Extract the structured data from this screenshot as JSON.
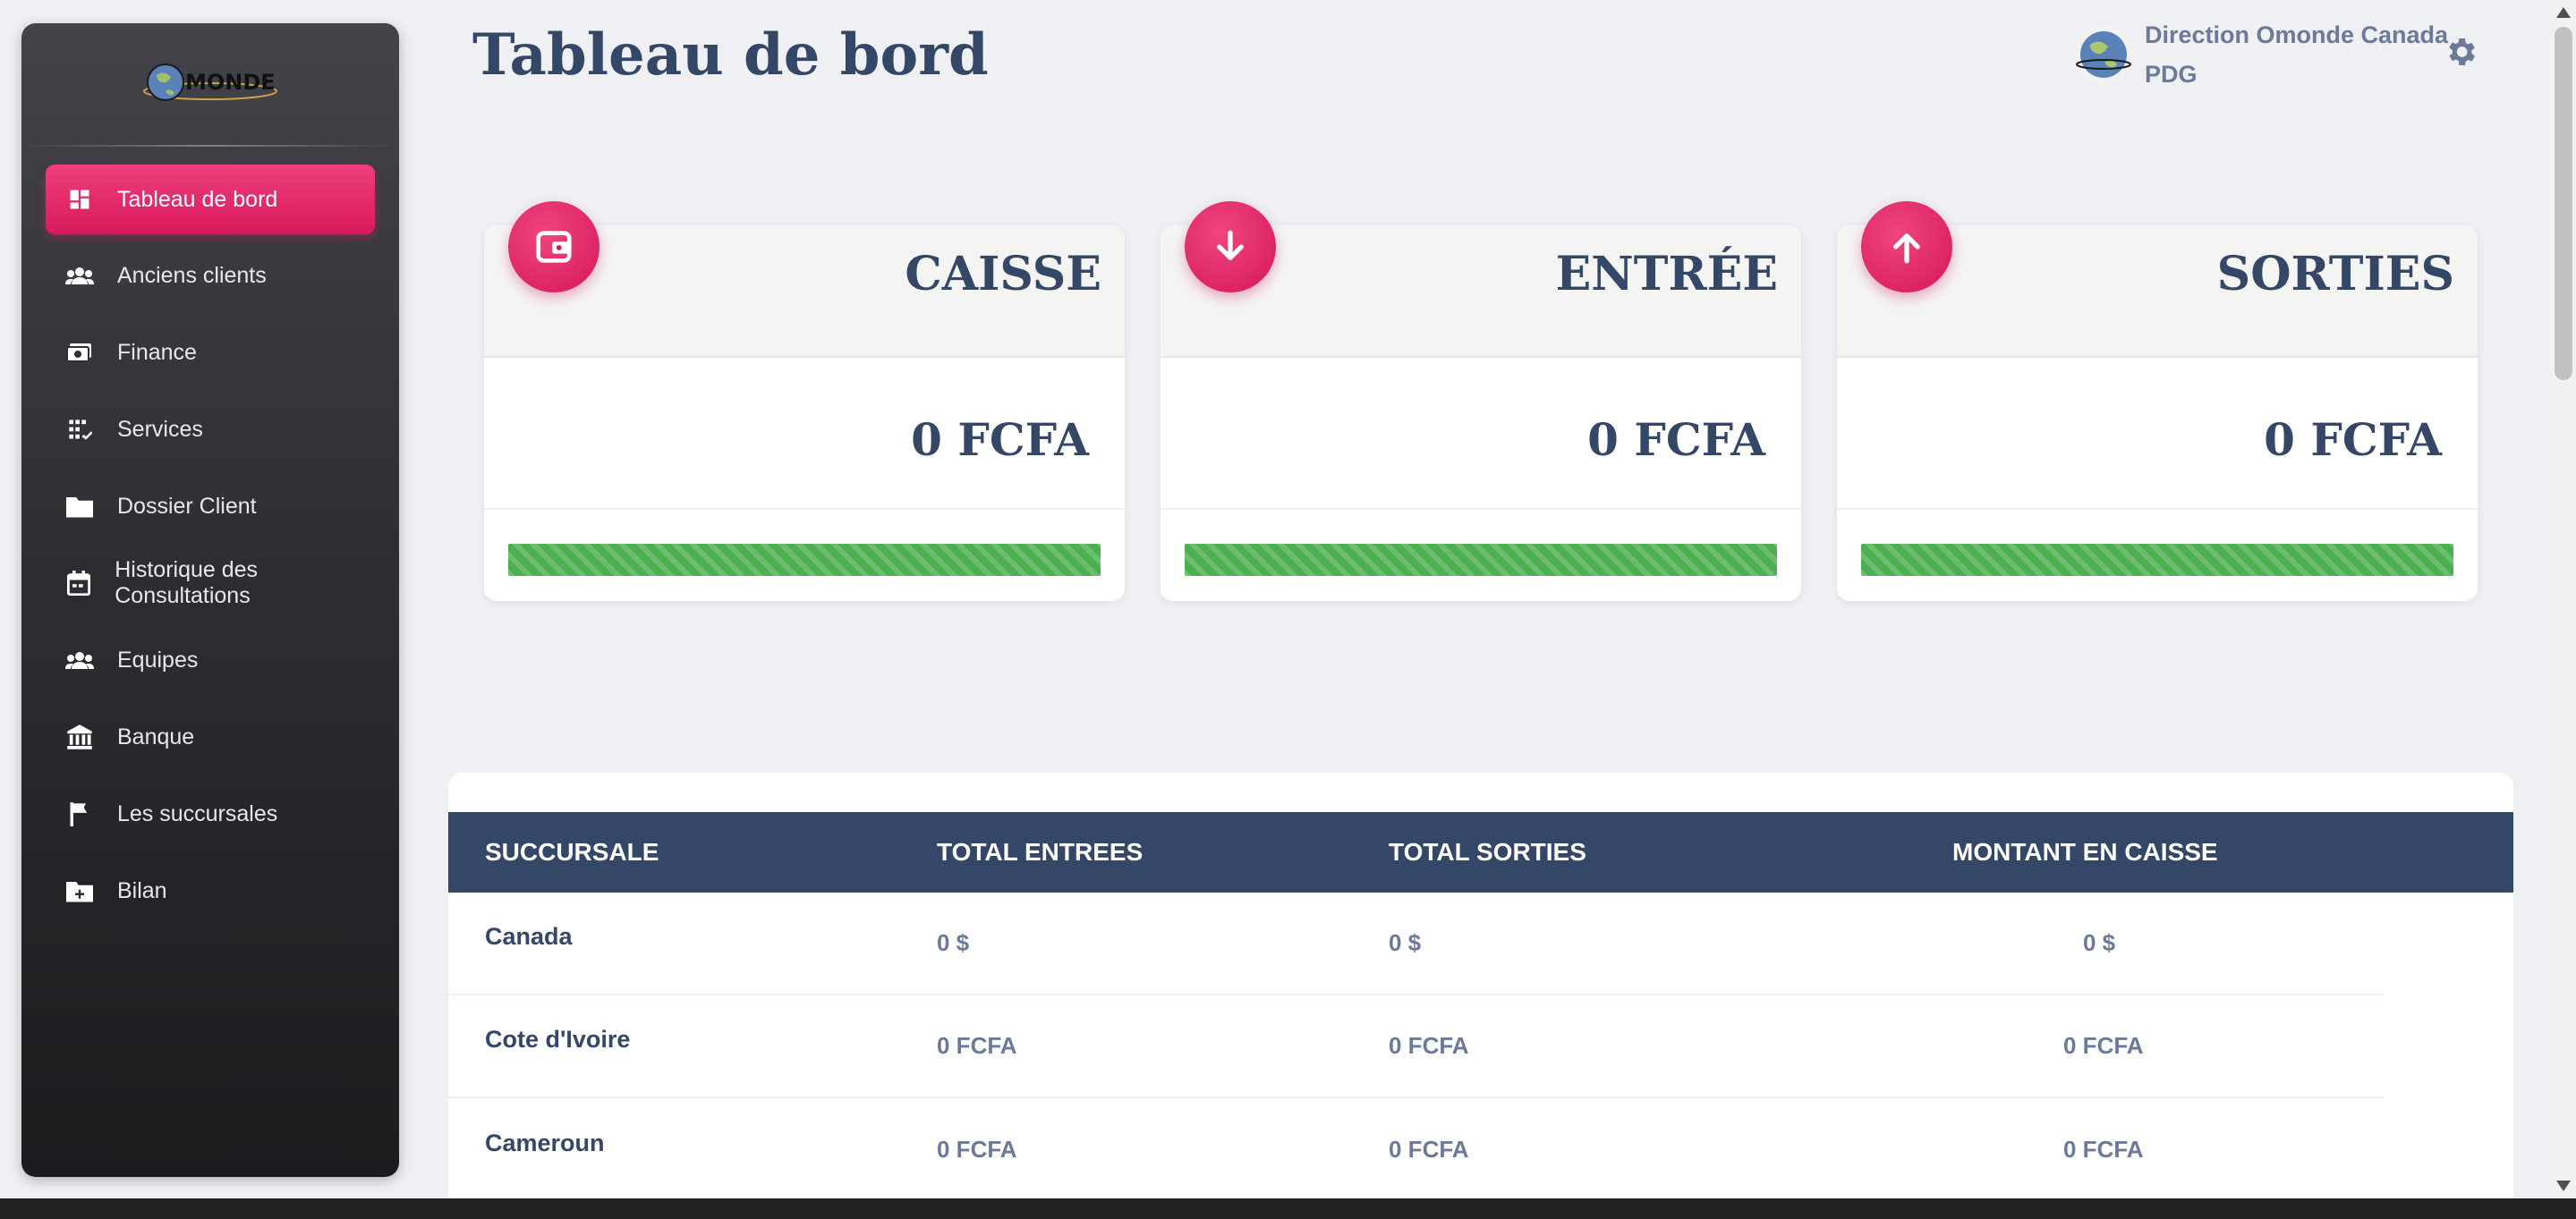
{
  "app": {
    "logo_text": "MONDE"
  },
  "sidebar": {
    "items": [
      {
        "label": "Tableau de bord",
        "icon": "dashboard-icon"
      },
      {
        "label": "Anciens clients",
        "icon": "people-icon"
      },
      {
        "label": "Finance",
        "icon": "money-icon"
      },
      {
        "label": "Services",
        "icon": "services-icon"
      },
      {
        "label": "Dossier Client",
        "icon": "folder-icon"
      },
      {
        "label": "Historique des Consultations",
        "icon": "calendar-icon"
      },
      {
        "label": "Equipes",
        "icon": "team-icon"
      },
      {
        "label": "Banque",
        "icon": "bank-icon"
      },
      {
        "label": "Les succursales",
        "icon": "flag-icon"
      },
      {
        "label": "Bilan",
        "icon": "folder-plus-icon"
      }
    ],
    "active_index": 0
  },
  "header": {
    "title": "Tableau de bord",
    "user_name": "Direction Omonde Canada",
    "user_role": "PDG"
  },
  "cards": [
    {
      "title": "CAISSE",
      "amount": "0 FCFA",
      "icon": "wallet-icon",
      "progress": 1.0
    },
    {
      "title": "ENTRÉE",
      "amount": "0 FCFA",
      "icon": "arrow-down-icon",
      "progress": 1.0
    },
    {
      "title": "SORTIES",
      "amount": "0 FCFA",
      "icon": "arrow-up-icon",
      "progress": 1.0
    }
  ],
  "table": {
    "columns": [
      "SUCCURSALE",
      "TOTAL ENTREES",
      "TOTAL SORTIES",
      "MONTANT EN CAISSE"
    ],
    "rows": [
      {
        "succursale": "Canada",
        "entrees": "0 $",
        "sorties": "0 $",
        "caisse": "0 $"
      },
      {
        "succursale": "Cote d'Ivoire",
        "entrees": "0 FCFA",
        "sorties": "0 FCFA",
        "caisse": "0 FCFA"
      },
      {
        "succursale": "Cameroun",
        "entrees": "0 FCFA",
        "sorties": "0 FCFA",
        "caisse": "0 FCFA"
      }
    ]
  },
  "colors": {
    "accent": "#e91e63",
    "header_dark": "#344767",
    "progress": "#4caf50",
    "sidebar_dark": "#2e2e33"
  }
}
